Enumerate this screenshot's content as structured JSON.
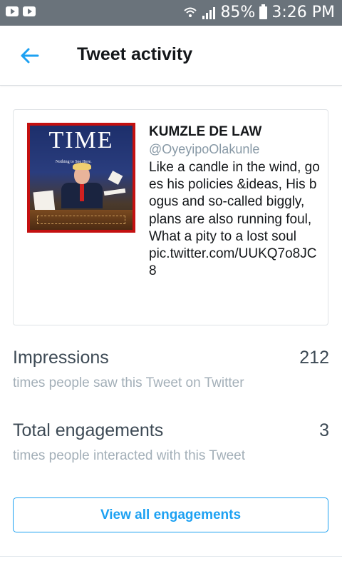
{
  "status_bar": {
    "battery_percent": "85%",
    "time": "3:26 PM",
    "icons": [
      "youtube-icon",
      "youtube-icon",
      "wifi-icon",
      "signal-icon",
      "battery-icon"
    ]
  },
  "header": {
    "back_icon": "back-arrow-icon",
    "title": "Tweet activity"
  },
  "tweet": {
    "image": {
      "logo_text": "TIME",
      "subtitle": "Nothing to See Here."
    },
    "author_name": "KUMZLE DE LAW",
    "author_handle": "@OyeyipoOlakunle",
    "text": "Like a candle in the wind, goes his policies &ideas, His bogus and so-called biggly,\nplans are also running foul,\nWhat a pity to a lost soul\npic.twitter.com/UUKQ7o8JC8"
  },
  "metrics": {
    "impressions": {
      "label": "Impressions",
      "value": "212",
      "description": "times people saw this Tweet on Twitter"
    },
    "engagements": {
      "label": "Total engagements",
      "value": "3",
      "description": "times people interacted with this Tweet"
    }
  },
  "actions": {
    "view_all_label": "View all engagements"
  },
  "colors": {
    "accent": "#1da1f2",
    "status_bar": "#6a737b",
    "muted_text": "#a3afb8"
  }
}
